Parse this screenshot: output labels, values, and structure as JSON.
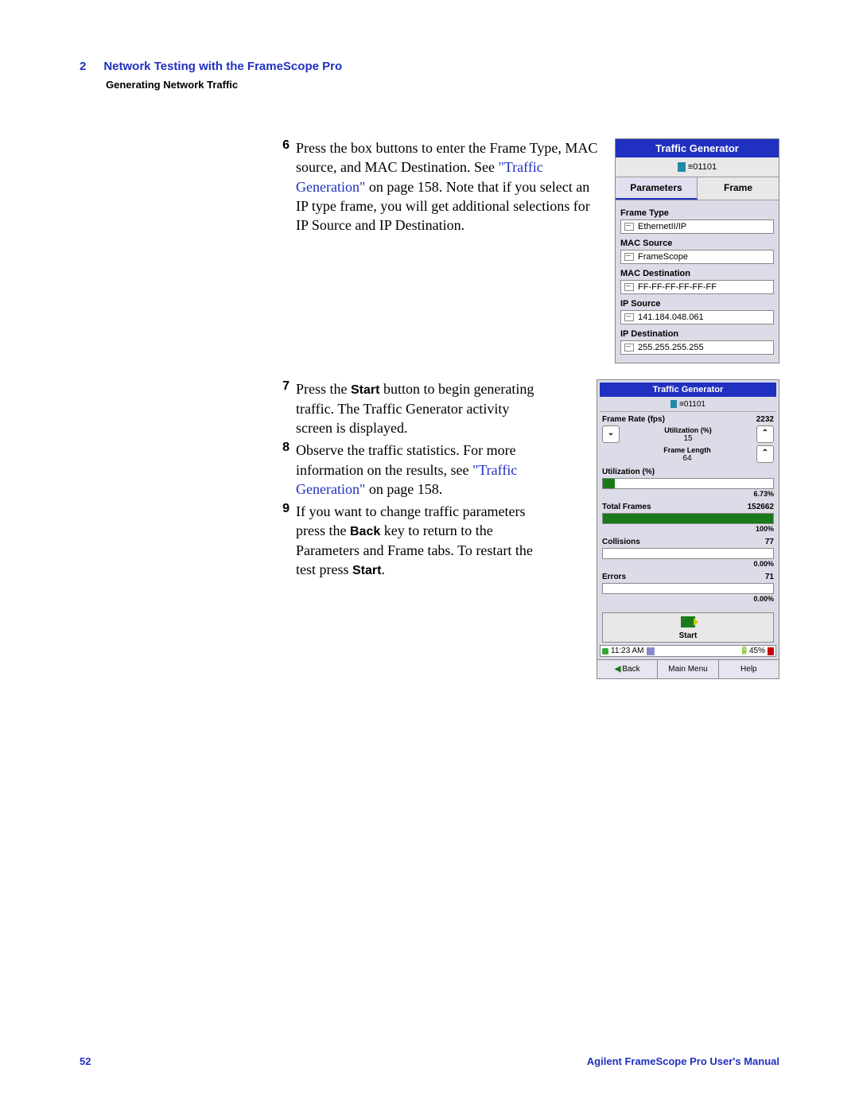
{
  "header": {
    "chapter_num": "2",
    "chapter_title": "Network Testing with the FrameScope Pro",
    "section_title": "Generating Network Traffic"
  },
  "steps": {
    "s6": {
      "num": "6",
      "text_a": "Press the box buttons to enter the Frame Type, MAC source, and MAC Destination. See ",
      "link": "\"Traffic Generation\"",
      "text_b": " on page 158. Note that if you select an IP type frame, you will get additional selections for IP Source and IP Destination."
    },
    "s7": {
      "num": "7",
      "text_a": "Press the ",
      "bold": "Start",
      "text_b": " button to begin generating traffic. The Traffic Generator activity screen is displayed."
    },
    "s8": {
      "num": "8",
      "text_a": "Observe the traffic statistics. For more information on the results, see ",
      "link": "\"Traffic Generation\"",
      "text_b": " on page 158."
    },
    "s9": {
      "num": "9",
      "text_a": "If you want to change traffic parameters press the ",
      "bold1": "Back",
      "text_b": " key to return to the Parameters and Frame tabs. To restart the test press ",
      "bold2": "Start",
      "text_c": "."
    }
  },
  "device1": {
    "title": "Traffic Generator",
    "subbar": "≡01101",
    "tabs": {
      "t1": "Parameters",
      "t2": "Frame"
    },
    "fields": {
      "frame_type": {
        "label": "Frame Type",
        "value": "EthernetII/IP"
      },
      "mac_source": {
        "label": "MAC Source",
        "value": "FrameScope"
      },
      "mac_dest": {
        "label": "MAC Destination",
        "value": "FF-FF-FF-FF-FF-FF"
      },
      "ip_source": {
        "label": "IP Source",
        "value": "141.184.048.061"
      },
      "ip_dest": {
        "label": "IP Destination",
        "value": "255.255.255.255"
      }
    }
  },
  "device2": {
    "title": "Traffic Generator",
    "subbar": "≡01101",
    "frame_rate": {
      "label": "Frame Rate (fps)",
      "value": "2232"
    },
    "util_ctrl": {
      "label": "Utilization (%)",
      "value": "15"
    },
    "flen_ctrl": {
      "label": "Frame Length",
      "value": "64"
    },
    "utilization": {
      "label": "Utilization (%)",
      "pct": "6.73%",
      "fill": 7
    },
    "total_frames": {
      "label": "Total Frames",
      "value": "152662",
      "pct": "100%",
      "fill": 100
    },
    "collisions": {
      "label": "Collisions",
      "value": "77",
      "pct": "0.00%",
      "fill": 0
    },
    "errors": {
      "label": "Errors",
      "value": "71",
      "pct": "0.00%",
      "fill": 0
    },
    "start": "Start",
    "status": {
      "time": "11:23 AM",
      "batt": "45%"
    },
    "nav": {
      "back": "Back",
      "main": "Main Menu",
      "help": "Help"
    }
  },
  "footer": {
    "page": "52",
    "manual": "Agilent FrameScope Pro User's Manual"
  }
}
